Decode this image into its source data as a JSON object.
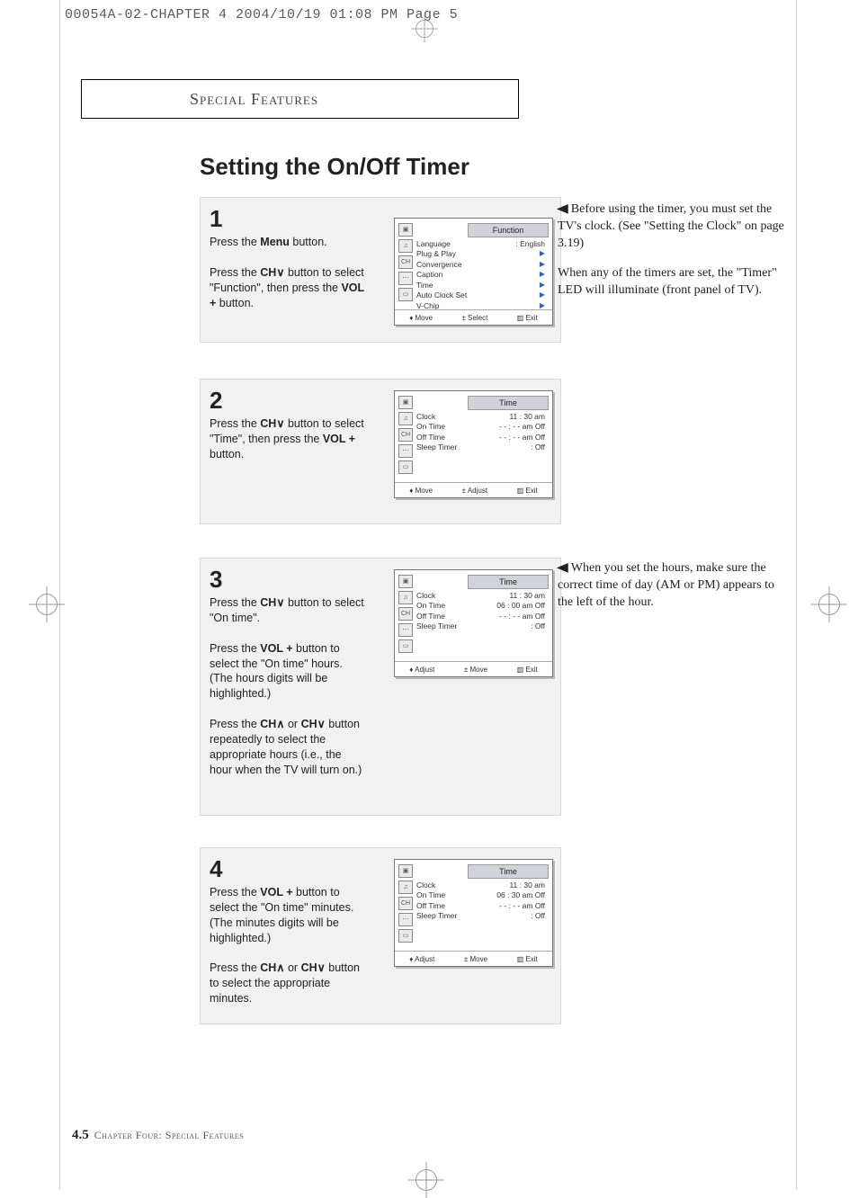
{
  "header_imprint": "00054A-02-CHAPTER 4  2004/10/19  01:08 PM  Page 5",
  "section_header": "Special Features",
  "page_title": "Setting the On/Off Timer",
  "steps": {
    "s1": {
      "num": "1",
      "p1_a": "Press the ",
      "p1_b": "Menu",
      "p1_c": " button.",
      "p2_a": "Press the ",
      "p2_b": "CH",
      "p2_c": " button to select \"Function\", then press the ",
      "p2_d": "VOL +",
      "p2_e": " button."
    },
    "s2": {
      "num": "2",
      "p1_a": "Press the ",
      "p1_b": "CH",
      "p1_c": " button to select \"Time\", then press the ",
      "p1_d": "VOL +",
      "p1_e": " button."
    },
    "s3": {
      "num": "3",
      "p1_a": "Press the ",
      "p1_b": "CH",
      "p1_c": " button to select \"On time\".",
      "p2_a": "Press the ",
      "p2_b": "VOL +",
      "p2_c": " button to select the \"On time\" hours. (The hours digits will be highlighted.)",
      "p3_a": "Press the ",
      "p3_b": "CH",
      "p3_mid": "  or  ",
      "p3_c": "CH",
      "p3_d": " button repeatedly to select the appropriate hours (i.e., the hour when the TV will turn on.)"
    },
    "s4": {
      "num": "4",
      "p1_a": "Press the ",
      "p1_b": "VOL +",
      "p1_c": " button to select the \"On time\" minutes.",
      "p1_d": "(The minutes digits will be highlighted.)",
      "p2_a": "Press the ",
      "p2_b": "CH",
      "p2_mid": "  or  ",
      "p2_c": "CH",
      "p2_d": " button to select the appropriate minutes."
    }
  },
  "osd": {
    "function": {
      "title": "Function",
      "rows": [
        {
          "l": "Language",
          "r": ": English"
        },
        {
          "l": "Plug & Play",
          "r": "▶"
        },
        {
          "l": "Convergence",
          "r": "▶"
        },
        {
          "l": "Caption",
          "r": "▶"
        },
        {
          "l": "Time",
          "r": "▶"
        },
        {
          "l": "Auto Clock Set",
          "r": "▶"
        },
        {
          "l": "V-Chip",
          "r": "▶"
        }
      ],
      "footer": [
        "♦ Move",
        "± Select",
        "▥ Exit"
      ]
    },
    "time2": {
      "title": "Time",
      "rows": [
        {
          "l": "Clock",
          "r": "11 : 30 am"
        },
        {
          "l": "On Time",
          "r": "- - : - - am Off"
        },
        {
          "l": "Off Time",
          "r": "- - : - - am Off"
        },
        {
          "l": "Sleep Timer",
          "r": ":   Off"
        }
      ],
      "footer": [
        "♦ Move",
        "± Adjust",
        "▥ Exit"
      ]
    },
    "time3": {
      "title": "Time",
      "rows": [
        {
          "l": "Clock",
          "r": "11 : 30 am"
        },
        {
          "l": "On Time",
          "r": "06 : 00 am Off"
        },
        {
          "l": "Off Time",
          "r": "- - : - - am Off"
        },
        {
          "l": "Sleep Timer",
          "r": ":   Off"
        }
      ],
      "footer": [
        "♦ Adjust",
        "± Move",
        "▥ Exit"
      ]
    },
    "time4": {
      "title": "Time",
      "rows": [
        {
          "l": "Clock",
          "r": "11 : 30 am"
        },
        {
          "l": "On Time",
          "r": "06 : 30 am Off"
        },
        {
          "l": "Off Time",
          "r": "- - : - - am Off"
        },
        {
          "l": "Sleep Timer",
          "r": ":   Off"
        }
      ],
      "footer": [
        "♦ Adjust",
        "± Move",
        "▥ Exit"
      ]
    }
  },
  "notes": {
    "n1a": "Before using the timer, you must set the TV's clock. (See \"Setting the Clock\" on page 3.19)",
    "n1b": "When any of the timers are set, the \"Timer\" LED will illuminate (front panel of TV).",
    "n2": "When you set the hours, make sure the correct time of day (AM or PM) appears to the left of the hour."
  },
  "footer": {
    "page": "4.5",
    "label": "Chapter Four: Special Features"
  },
  "glyphs": {
    "down": "∨",
    "up": "∧",
    "left_tri": "◀"
  }
}
